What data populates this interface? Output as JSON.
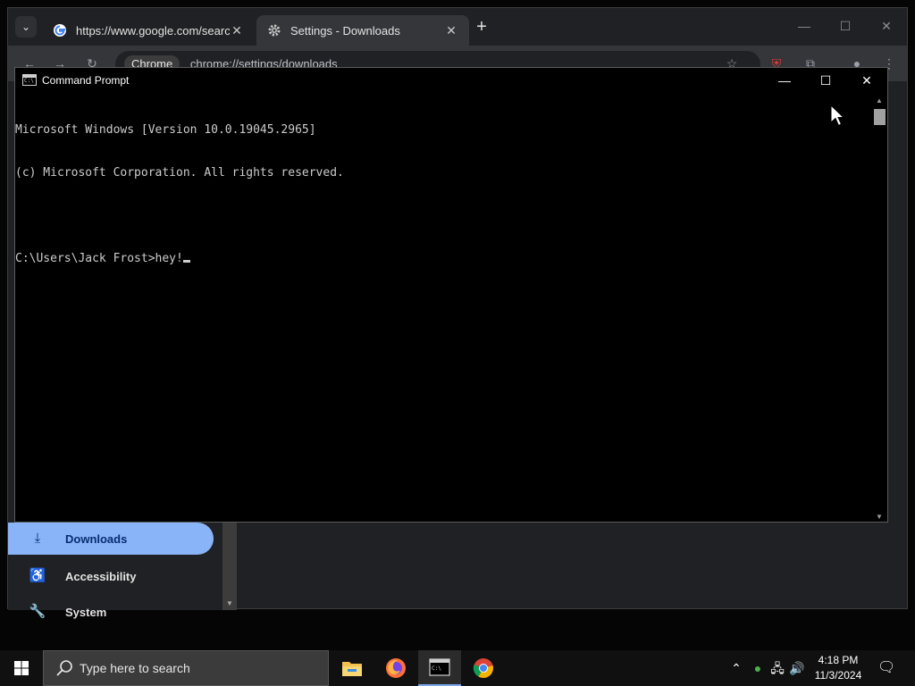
{
  "chrome": {
    "tabs": [
      {
        "title": "https://www.google.com/search",
        "close": "✕",
        "favicon": "google-favicon"
      },
      {
        "title": "Settings - Downloads",
        "close": "✕",
        "favicon": "gear-icon"
      }
    ],
    "new_tab": "+",
    "window_controls": {
      "minimize": "—",
      "maximize": "☐",
      "close": "✕"
    },
    "omnibox": {
      "chip": "Chrome",
      "url": "chrome://settings/downloads"
    },
    "sidebar": [
      {
        "label": "Downloads",
        "icon": "download-icon",
        "glyph": "⤓",
        "selected": true
      },
      {
        "label": "Accessibility",
        "icon": "accessibility-icon",
        "glyph": "♿",
        "selected": false
      },
      {
        "label": "System",
        "icon": "wrench-icon",
        "glyph": "🔧",
        "selected": false
      }
    ]
  },
  "cmd": {
    "title": "Command Prompt",
    "controls": {
      "minimize": "—",
      "maximize": "☐",
      "close": "✕"
    },
    "lines": [
      "Microsoft Windows [Version 10.0.19045.2965]",
      "(c) Microsoft Corporation. All rights reserved.",
      "",
      "C:\\Users\\Jack Frost>hey!"
    ]
  },
  "taskbar": {
    "search_placeholder": "Type here to search",
    "apps": [
      "file-explorer-icon",
      "firefox-icon",
      "command-prompt-icon",
      "chrome-icon"
    ],
    "time": "4:18 PM",
    "date": "11/3/2024"
  },
  "colors": {
    "chrome_bg": "#202124",
    "accent_blue": "#8ab4f8",
    "console_text": "#cccccc",
    "taskbar_bg": "#101010"
  }
}
